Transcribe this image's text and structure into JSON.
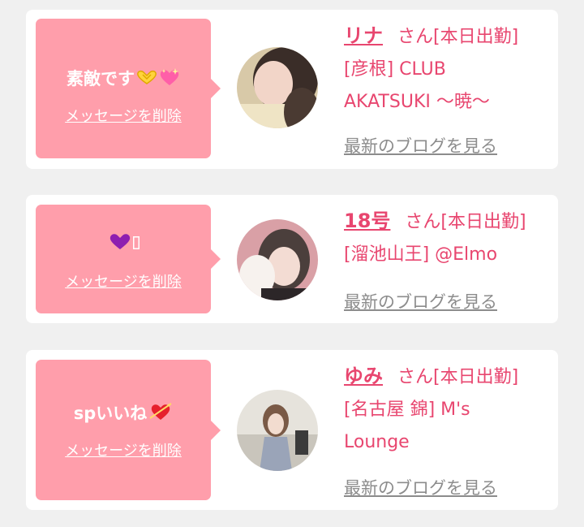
{
  "colors": {
    "accent": "#e8466f",
    "bubble": "#ff9eab",
    "link_gray": "#8c8c8c",
    "card": "#ffffff",
    "background": "#f0f0f0"
  },
  "cards": [
    {
      "message": "素敵です",
      "message_emojis": [
        "heart-hands-icon",
        "sparkling-heart-icon"
      ],
      "delete_label": "メッセージを削除",
      "name": "リナ",
      "suffix": "さん[本日出勤]",
      "location_line1": "[彦根] CLUB",
      "location_line2": "AKATSUKI ～暁～",
      "blog_link": "最新のブログを見る"
    },
    {
      "message": "",
      "message_emojis": [
        "purple-heart-icon",
        "missing-glyph-icon"
      ],
      "delete_label": "メッセージを削除",
      "name": "18号",
      "suffix": "さん[本日出勤]",
      "location_line1": "[溜池山王] @Elmo",
      "location_line2": "",
      "blog_link": "最新のブログを見る"
    },
    {
      "message": "spいいね",
      "message_emojis": [
        "heart-with-arrow-icon"
      ],
      "delete_label": "メッセージを削除",
      "name": "ゆみ",
      "suffix": "さん[本日出勤]",
      "location_line1": "[名古屋 錦] M's",
      "location_line2": "Lounge",
      "blog_link": "最新のブログを見る"
    }
  ]
}
